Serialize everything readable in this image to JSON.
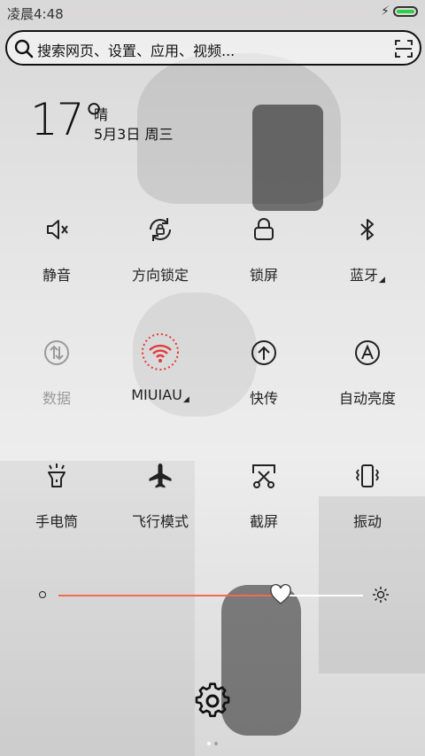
{
  "status_bar": {
    "time": "凌晨4:48",
    "battery_color": "#2bd23f"
  },
  "search": {
    "placeholder": "搜索网页、设置、应用、视频..."
  },
  "weather": {
    "temperature": "17°",
    "condition": "晴",
    "date": "5月3日 周三"
  },
  "toggles": [
    {
      "label": "静音",
      "icon": "mute-icon",
      "active": false
    },
    {
      "label": "方向锁定",
      "icon": "rotation-lock-icon",
      "active": false
    },
    {
      "label": "锁屏",
      "icon": "lock-icon",
      "active": false
    },
    {
      "label": "蓝牙",
      "icon": "bluetooth-icon",
      "active": false,
      "has_menu": true
    },
    {
      "label": "数据",
      "icon": "mobile-data-icon",
      "active": false,
      "muted": true
    },
    {
      "label": "MIUIAU",
      "icon": "wifi-icon",
      "active": true,
      "has_menu": true,
      "accent": "#e23b3b"
    },
    {
      "label": "快传",
      "icon": "quick-transfer-icon",
      "active": false
    },
    {
      "label": "自动亮度",
      "icon": "auto-brightness-icon",
      "active": false
    },
    {
      "label": "手电筒",
      "icon": "flashlight-icon",
      "active": false
    },
    {
      "label": "飞行模式",
      "icon": "airplane-icon",
      "active": false
    },
    {
      "label": "截屏",
      "icon": "screenshot-icon",
      "active": false
    },
    {
      "label": "振动",
      "icon": "vibrate-icon",
      "active": false
    }
  ],
  "brightness": {
    "level": 0.73,
    "track_color": "#f26a55"
  },
  "menu_indicator": "◢",
  "pager": {
    "pages": 2,
    "current": 1
  }
}
